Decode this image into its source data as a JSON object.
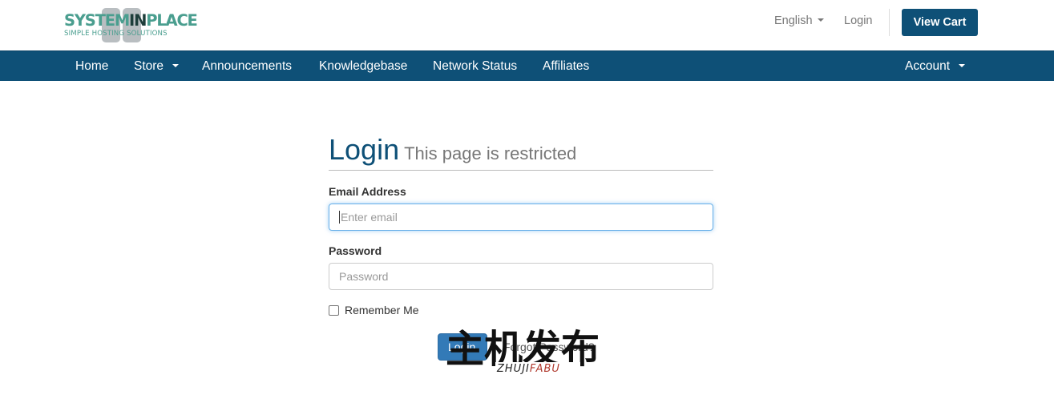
{
  "header": {
    "logo": {
      "word_part1": "SYSTEM",
      "word_part2": "IN",
      "word_part3": "PLACE",
      "tagline": "SIMPLE HOSTING SOLUTIONS"
    },
    "language_label": "English",
    "login_label": "Login",
    "view_cart_label": "View Cart"
  },
  "navbar": {
    "items": [
      {
        "label": "Home"
      },
      {
        "label": "Store"
      },
      {
        "label": "Announcements"
      },
      {
        "label": "Knowledgebase"
      },
      {
        "label": "Network Status"
      },
      {
        "label": "Affiliates"
      }
    ],
    "account_label": "Account"
  },
  "login_form": {
    "title": "Login",
    "subtitle": "This page is restricted",
    "email_label": "Email Address",
    "email_placeholder": "Enter email",
    "password_label": "Password",
    "password_placeholder": "Password",
    "remember_label": "Remember Me",
    "remember_checked": false,
    "submit_label": "Login",
    "forgot_label": "Forgot Password?"
  },
  "watermark": {
    "chinese": "主机发布",
    "latin_part1": "ZHUJI",
    "latin_part2": "FABU"
  },
  "colors": {
    "brand": "#0e5077",
    "button": "#337ab7",
    "logo_teal": "#4a9e8f"
  }
}
